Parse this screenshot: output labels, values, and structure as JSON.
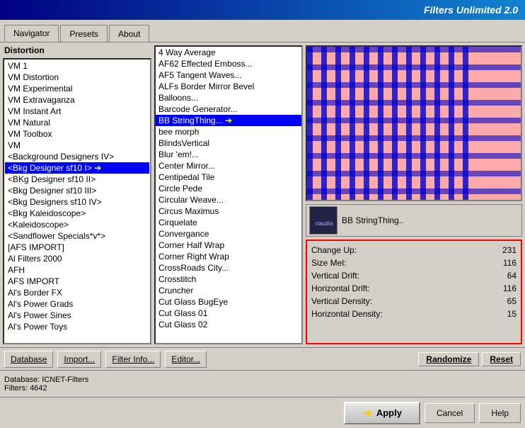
{
  "titleBar": {
    "text": "Filters Unlimited 2.0"
  },
  "tabs": [
    {
      "id": "navigator",
      "label": "Navigator",
      "active": true
    },
    {
      "id": "presets",
      "label": "Presets",
      "active": false
    },
    {
      "id": "about",
      "label": "About",
      "active": false
    }
  ],
  "leftPanel": {
    "label": "Distortion",
    "items": [
      {
        "id": "vm1",
        "text": "VM 1",
        "selected": false
      },
      {
        "id": "vm-distortion",
        "text": "VM Distortion",
        "selected": false
      },
      {
        "id": "vm-experimental",
        "text": "VM Experimental",
        "selected": false
      },
      {
        "id": "vm-extravaganza",
        "text": "VM Extravaganza",
        "selected": false
      },
      {
        "id": "vm-instant-art",
        "text": "VM Instant Art",
        "selected": false
      },
      {
        "id": "vm-natural",
        "text": "VM Natural",
        "selected": false
      },
      {
        "id": "vm-toolbox",
        "text": "VM Toolbox",
        "selected": false
      },
      {
        "id": "vm",
        "text": "VM",
        "selected": false
      },
      {
        "id": "bkg-designers-iv",
        "text": "&<Background Designers IV>",
        "selected": false
      },
      {
        "id": "bkg-designer-sf10i",
        "text": "&<Bkg Designer sf10 I>",
        "selected": true,
        "arrow": true
      },
      {
        "id": "bkg-designer-sf10ii",
        "text": "&<BKg Designer sf10 II>",
        "selected": false
      },
      {
        "id": "bkg-designer-sf10iii",
        "text": "&<Bkg Designer sf10 III>",
        "selected": false
      },
      {
        "id": "bkg-designers-sf10iv",
        "text": "&<Bkg Designers sf10 IV>",
        "selected": false
      },
      {
        "id": "bkg-kaleidoscope",
        "text": "&<Bkg Kaleidoscope>",
        "selected": false
      },
      {
        "id": "kaleidoscope",
        "text": "&<Kaleidoscope>",
        "selected": false
      },
      {
        "id": "sandflower-specials",
        "text": "&<Sandflower Specials*v*>",
        "selected": false
      },
      {
        "id": "afs-import",
        "text": "[AFS IMPORT]",
        "selected": false
      },
      {
        "id": "al-filters-2000",
        "text": "Al Filters 2000",
        "selected": false
      },
      {
        "id": "afh",
        "text": "AFH",
        "selected": false
      },
      {
        "id": "afs-import2",
        "text": "AFS IMPORT",
        "selected": false
      },
      {
        "id": "als-border-fx",
        "text": "Al's Border FX",
        "selected": false
      },
      {
        "id": "als-power-grads",
        "text": "Al's Power Grads",
        "selected": false
      },
      {
        "id": "als-power-sines",
        "text": "Al's Power Sines",
        "selected": false
      },
      {
        "id": "als-power-toys",
        "text": "Al's Power Toys",
        "selected": false
      }
    ]
  },
  "filterList": {
    "items": [
      {
        "id": "4way-avg",
        "text": "4 Way Average",
        "selected": false
      },
      {
        "id": "af62",
        "text": "AF62 Effected Emboss...",
        "selected": false
      },
      {
        "id": "af5-tangent",
        "text": "AF5 Tangent Waves...",
        "selected": false
      },
      {
        "id": "alfs-border",
        "text": "ALFs Border Mirror Bevel",
        "selected": false
      },
      {
        "id": "balloons",
        "text": "Balloons...",
        "selected": false
      },
      {
        "id": "barcode",
        "text": "Barcode Generator...",
        "selected": false
      },
      {
        "id": "bb-string",
        "text": "BB StringThing...",
        "selected": true,
        "arrow": true
      },
      {
        "id": "bee-morph",
        "text": "bee morph",
        "selected": false
      },
      {
        "id": "blinds-vertical",
        "text": "BlindsVertical",
        "selected": false
      },
      {
        "id": "blur-em",
        "text": "Blur 'em!...",
        "selected": false
      },
      {
        "id": "center-mirror",
        "text": "Center Mirror...",
        "selected": false
      },
      {
        "id": "centipedal-tile",
        "text": "Centipedal Tile",
        "selected": false
      },
      {
        "id": "circle-pede",
        "text": "Circle Pede",
        "selected": false
      },
      {
        "id": "circular-weave",
        "text": "Circular Weave...",
        "selected": false
      },
      {
        "id": "circus-maximus",
        "text": "Circus Maximus",
        "selected": false
      },
      {
        "id": "cirquelate",
        "text": "Cirquelate",
        "selected": false
      },
      {
        "id": "convergance",
        "text": "Convergance",
        "selected": false
      },
      {
        "id": "corner-half-wrap",
        "text": "Corner Half Wrap",
        "selected": false
      },
      {
        "id": "corner-right-wrap",
        "text": "Corner Right Wrap",
        "selected": false
      },
      {
        "id": "crossroads-city",
        "text": "CrossRoads City...",
        "selected": false
      },
      {
        "id": "crosstitch",
        "text": "Crosstitch",
        "selected": false
      },
      {
        "id": "cruncher",
        "text": "Cruncher",
        "selected": false
      },
      {
        "id": "cut-glass-bugeye",
        "text": "Cut Glass  BugEye",
        "selected": false
      },
      {
        "id": "cut-glass-01",
        "text": "Cut Glass 01",
        "selected": false
      },
      {
        "id": "cut-glass-02",
        "text": "Cut Glass 02",
        "selected": false
      }
    ]
  },
  "preview": {
    "filterName": "BB StringThing..",
    "thumbnailAlt": "thumbnail"
  },
  "params": {
    "rows": [
      {
        "label": "Change Up:",
        "value": "231"
      },
      {
        "label": "Size Mel:",
        "value": "116"
      },
      {
        "label": "Vertical Drift:",
        "value": "64"
      },
      {
        "label": "Horizontal Drift:",
        "value": "116"
      },
      {
        "label": "Vertical Density:",
        "value": "65"
      },
      {
        "label": "Horizontal Density:",
        "value": "15"
      }
    ]
  },
  "toolbar": {
    "database": "Database",
    "import": "Import...",
    "filterInfo": "Filter Info...",
    "editor": "Editor...",
    "randomize": "Randomize",
    "reset": "Reset"
  },
  "statusBar": {
    "database": "Database:",
    "databaseValue": "ICNET-Filters",
    "filters": "Filters:",
    "filtersValue": "4642"
  },
  "actionBar": {
    "apply": "Apply",
    "cancel": "Cancel",
    "help": "Help"
  }
}
